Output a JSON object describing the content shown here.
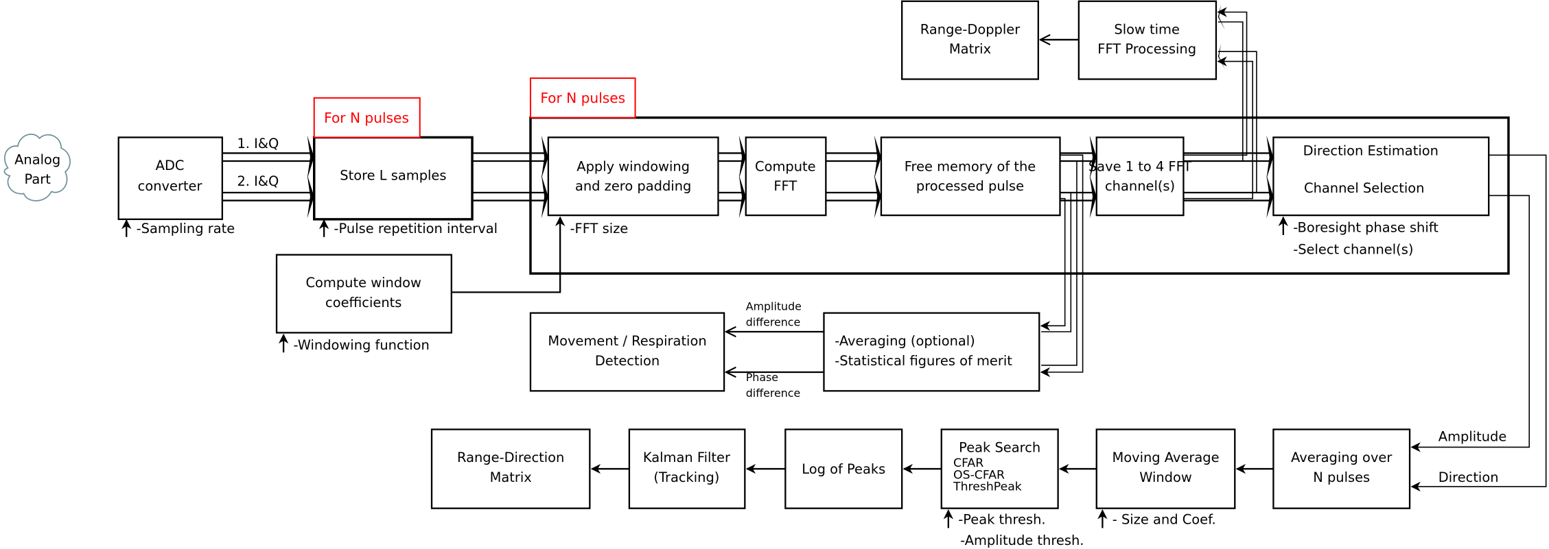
{
  "colors": {
    "accent": "#ff0000",
    "cloud_stroke": "#6f8f99",
    "line": "#000000"
  },
  "cloud": {
    "line1": "Analog",
    "line2": "Part"
  },
  "adc": {
    "line1": "ADC",
    "line2": "converter",
    "param": "-Sampling rate"
  },
  "iq": {
    "ch1": "1. I&Q",
    "ch2": "2. I&Q"
  },
  "store": {
    "label": "Store L samples",
    "param": "-Pulse repetition interval",
    "loop_label": "For N pulses"
  },
  "main_loop": {
    "label": "For N pulses"
  },
  "windowing": {
    "line1": "Apply windowing",
    "line2": "and zero padding",
    "param": "-FFT size"
  },
  "fft": {
    "line1": "Compute",
    "line2": "FFT"
  },
  "free_memory": {
    "line1": "Free memory of the",
    "line2": "processed pulse"
  },
  "save": {
    "line1": "Save 1 to 4 FFT",
    "line2": "channel(s)"
  },
  "direction": {
    "line1": "Direction Estimation",
    "line2": "Channel Selection",
    "param1": "-Boresight phase shift",
    "param2": "-Select channel(s)"
  },
  "range_doppler": {
    "line1": "Range-Doppler",
    "line2": "Matrix"
  },
  "slow_time": {
    "line1": "Slow time",
    "line2": "FFT Processing"
  },
  "window_coef": {
    "line1": "Compute window",
    "line2": "coefficients",
    "param": "-Windowing function"
  },
  "movement": {
    "line1": "Movement / Respiration",
    "line2": "Detection"
  },
  "averaging_opt": {
    "line1": "-Averaging (optional)",
    "line2": "-Statistical figures of merit"
  },
  "amp_diff": {
    "line1": "Amplitude",
    "line2": "difference"
  },
  "phase_diff": {
    "line1": "Phase",
    "line2": "difference"
  },
  "amplitude_label": "Amplitude",
  "direction_label": "Direction",
  "averaging_n": {
    "line1": "Averaging over",
    "line2": "N pulses"
  },
  "moving_avg": {
    "line1": "Moving Average",
    "line2": "Window",
    "param": "- Size and Coef."
  },
  "peak_search": {
    "title": "Peak Search",
    "m1": "CFAR",
    "m2": "OS-CFAR",
    "m3": "ThreshPeak",
    "param1": "-Peak thresh.",
    "param2": "-Amplitude thresh."
  },
  "log_peaks": {
    "label": "Log of Peaks"
  },
  "kalman": {
    "line1": "Kalman Filter",
    "line2": "(Tracking)"
  },
  "range_direction": {
    "line1": "Range-Direction",
    "line2": "Matrix"
  }
}
